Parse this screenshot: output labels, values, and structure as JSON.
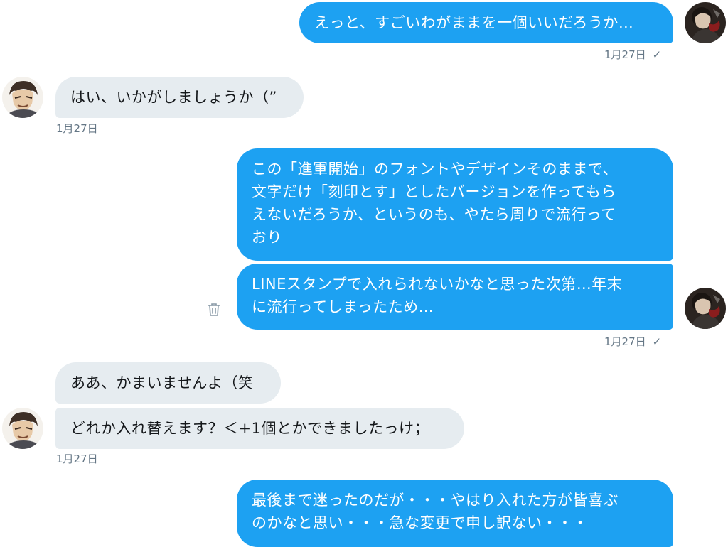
{
  "messages": [
    {
      "text": "えっと、すごいわがままを一個いいだろうか…"
    },
    {
      "text": "はい、いかがしましょうか（”"
    },
    {
      "text": "この「進軍開始」のフォントやデザインそのままで、\n文字だけ「刻印とす」としたバージョンを作ってもら\nえないだろうか、というのも、やたら周りで流行って\nおり"
    },
    {
      "text": "LINEスタンプで入れられないかなと思った次第…年末\nに流行ってしまったため…"
    },
    {
      "text": "ああ、かまいませんよ（笑"
    },
    {
      "text": "どれか入れ替えます？＜+1個とかできましたっけ；"
    },
    {
      "text": "最後まで迷ったのだが・・・やはり入れた方が皆喜ぶ\nのかなと思い・・・急な変更で申し訳ない・・・"
    }
  ],
  "timestamps": {
    "t1": "1月27日",
    "t2": "1月27日",
    "t3": "1月27日",
    "t4": "1月27日"
  },
  "read_mark": "✓",
  "icons": {
    "delete": "trash-icon"
  },
  "colors": {
    "outgoing_bubble": "#1da1f2",
    "incoming_bubble": "#e6ecf0",
    "meta_text": "#657786"
  }
}
